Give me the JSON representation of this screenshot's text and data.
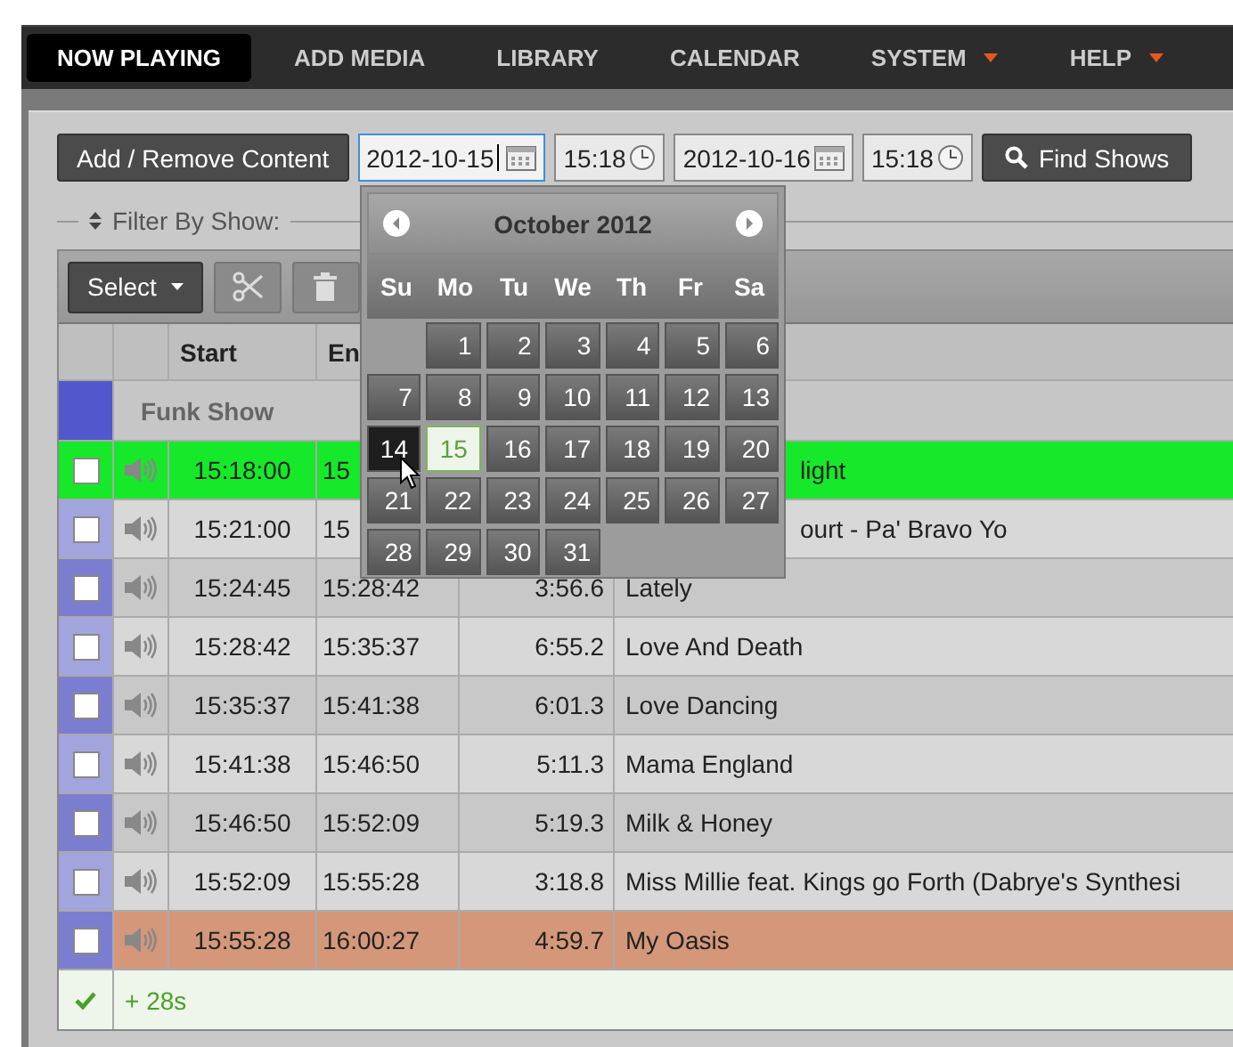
{
  "nav": [
    {
      "label": "NOW PLAYING",
      "selected": true,
      "has_menu": false
    },
    {
      "label": "ADD MEDIA",
      "selected": false,
      "has_menu": false
    },
    {
      "label": "LIBRARY",
      "selected": false,
      "has_menu": false
    },
    {
      "label": "CALENDAR",
      "selected": false,
      "has_menu": false
    },
    {
      "label": "SYSTEM",
      "selected": false,
      "has_menu": true
    },
    {
      "label": "HELP",
      "selected": false,
      "has_menu": true
    }
  ],
  "toolbar": {
    "add_button": "Add / Remove Content",
    "start_date": {
      "value": "2012-10-15",
      "focused": true
    },
    "start_time": {
      "value": "15:18",
      "focused": false
    },
    "end_date": {
      "value": "2012-10-16",
      "focused": false
    },
    "end_time": {
      "value": "15:18",
      "focused": false
    },
    "find_button": "Find Shows"
  },
  "filter": {
    "label": "Filter By Show:"
  },
  "table_toolbar": {
    "select_button": "Select"
  },
  "table": {
    "columns": [
      "Start",
      "En"
    ],
    "show": {
      "name": "Funk Show",
      "color": "#5058cc"
    },
    "rows": [
      {
        "checked": false,
        "start": "15:18:00",
        "end": "15",
        "title": "light",
        "playing": true,
        "overbooked": false
      },
      {
        "checked": false,
        "start": "15:21:00",
        "end": "15",
        "title": "ourt - Pa' Bravo Yo",
        "playing": false,
        "overbooked": false
      },
      {
        "checked": false,
        "start": "15:24:45",
        "end": "15:28:42",
        "duration": "3:56.6",
        "title": "Lately",
        "playing": false,
        "overbooked": false
      },
      {
        "checked": false,
        "start": "15:28:42",
        "end": "15:35:37",
        "duration": "6:55.2",
        "title": "Love And Death",
        "playing": false,
        "overbooked": false
      },
      {
        "checked": false,
        "start": "15:35:37",
        "end": "15:41:38",
        "duration": "6:01.3",
        "title": "Love Dancing",
        "playing": false,
        "overbooked": false
      },
      {
        "checked": false,
        "start": "15:41:38",
        "end": "15:46:50",
        "duration": "5:11.3",
        "title": "Mama England",
        "playing": false,
        "overbooked": false
      },
      {
        "checked": false,
        "start": "15:46:50",
        "end": "15:52:09",
        "duration": "5:19.3",
        "title": "Milk & Honey",
        "playing": false,
        "overbooked": false
      },
      {
        "checked": false,
        "start": "15:52:09",
        "end": "15:55:28",
        "duration": "3:18.8",
        "title": "Miss Millie feat. Kings go Forth (Dabrye's Synthesi",
        "playing": false,
        "overbooked": false
      },
      {
        "checked": false,
        "start": "15:55:28",
        "end": "16:00:27",
        "duration": "4:59.7",
        "title": "My Oasis",
        "playing": false,
        "overbooked": true
      }
    ],
    "footer": {
      "text": "+ 28s",
      "ok": true
    }
  },
  "calendar": {
    "title": "October 2012",
    "weekdays": [
      "Su",
      "Mo",
      "Tu",
      "We",
      "Th",
      "Fr",
      "Sa"
    ],
    "days": [
      {
        "kind": "blank"
      },
      {
        "kind": "day",
        "label": "1",
        "selected": false,
        "today": false
      },
      {
        "kind": "day",
        "label": "2",
        "selected": false,
        "today": false
      },
      {
        "kind": "day",
        "label": "3",
        "selected": false,
        "today": false
      },
      {
        "kind": "day",
        "label": "4",
        "selected": false,
        "today": false
      },
      {
        "kind": "day",
        "label": "5",
        "selected": false,
        "today": false
      },
      {
        "kind": "day",
        "label": "6",
        "selected": false,
        "today": false
      },
      {
        "kind": "day",
        "label": "7",
        "selected": false,
        "today": false
      },
      {
        "kind": "day",
        "label": "8",
        "selected": false,
        "today": false
      },
      {
        "kind": "day",
        "label": "9",
        "selected": false,
        "today": false
      },
      {
        "kind": "day",
        "label": "10",
        "selected": false,
        "today": false
      },
      {
        "kind": "day",
        "label": "11",
        "selected": false,
        "today": false
      },
      {
        "kind": "day",
        "label": "12",
        "selected": false,
        "today": false
      },
      {
        "kind": "day",
        "label": "13",
        "selected": false,
        "today": false
      },
      {
        "kind": "day",
        "label": "14",
        "selected": true,
        "today": false
      },
      {
        "kind": "day",
        "label": "15",
        "selected": false,
        "today": true
      },
      {
        "kind": "day",
        "label": "16",
        "selected": false,
        "today": false
      },
      {
        "kind": "day",
        "label": "17",
        "selected": false,
        "today": false
      },
      {
        "kind": "day",
        "label": "18",
        "selected": false,
        "today": false
      },
      {
        "kind": "day",
        "label": "19",
        "selected": false,
        "today": false
      },
      {
        "kind": "day",
        "label": "20",
        "selected": false,
        "today": false
      },
      {
        "kind": "day",
        "label": "21",
        "selected": false,
        "today": false
      },
      {
        "kind": "day",
        "label": "22",
        "selected": false,
        "today": false
      },
      {
        "kind": "day",
        "label": "23",
        "selected": false,
        "today": false
      },
      {
        "kind": "day",
        "label": "24",
        "selected": false,
        "today": false
      },
      {
        "kind": "day",
        "label": "25",
        "selected": false,
        "today": false
      },
      {
        "kind": "day",
        "label": "26",
        "selected": false,
        "today": false
      },
      {
        "kind": "day",
        "label": "27",
        "selected": false,
        "today": false
      },
      {
        "kind": "day",
        "label": "28",
        "selected": false,
        "today": false
      },
      {
        "kind": "day",
        "label": "29",
        "selected": false,
        "today": false
      },
      {
        "kind": "day",
        "label": "30",
        "selected": false,
        "today": false
      },
      {
        "kind": "day",
        "label": "31",
        "selected": false,
        "today": false
      }
    ]
  }
}
